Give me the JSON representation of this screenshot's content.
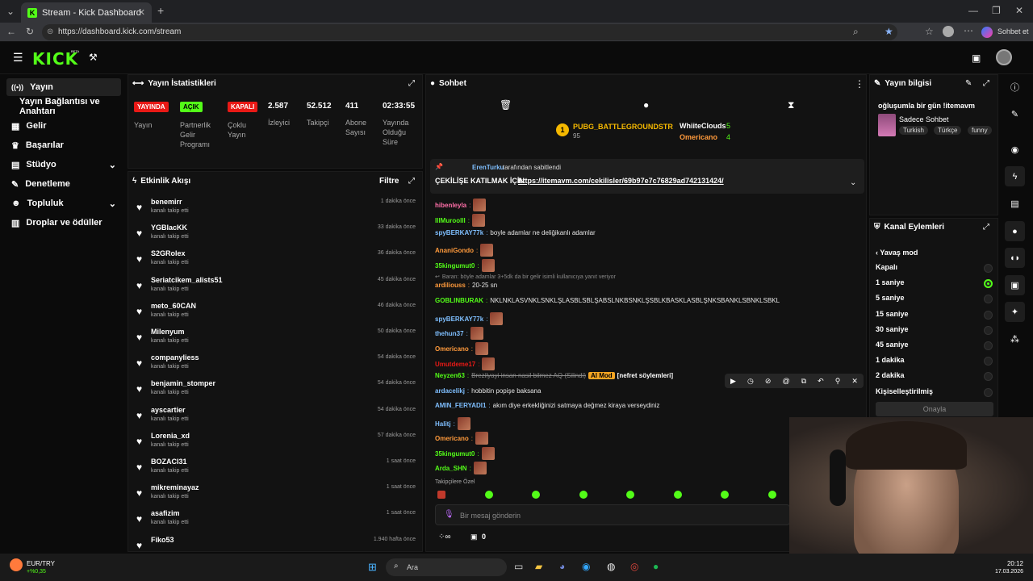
{
  "browser": {
    "tab_title": "Stream - Kick Dashboard",
    "url": "https://dashboard.kick.com/stream",
    "profile_label": "Sohbet et"
  },
  "app": {
    "logo": "KICK",
    "logo_beta": "BETA"
  },
  "sidebar": {
    "items": [
      {
        "label": "Yayın",
        "icon": "broadcast-icon"
      },
      {
        "label": "Yayın Bağlantısı ve Anahtarı",
        "icon": ""
      },
      {
        "label": "Gelir",
        "icon": "money-icon"
      },
      {
        "label": "Başarılar",
        "icon": "trophy-icon"
      },
      {
        "label": "Stüdyo",
        "icon": "studio-icon"
      },
      {
        "label": "Denetleme",
        "icon": "wrench-icon"
      },
      {
        "label": "Topluluk",
        "icon": "community-icon"
      },
      {
        "label": "Droplar ve ödüller",
        "icon": "drops-icon"
      }
    ]
  },
  "stats": {
    "title": "Yayın İstatistikleri",
    "items": [
      {
        "badge": "YAYINDA",
        "label": "Yayın",
        "badge_color": "#e91916"
      },
      {
        "badge": "AÇIK",
        "label": "Partnerlik Gelir Programı",
        "badge_color": "#53fc18"
      },
      {
        "badge": "KAPALI",
        "label": "Çoklu Yayın",
        "badge_color": "#e91916"
      },
      {
        "value": "2.587",
        "label": "İzleyici"
      },
      {
        "value": "52.512",
        "label": "Takipçi"
      },
      {
        "value": "411",
        "label": "Abone Sayısı"
      },
      {
        "value": "02:33:55",
        "label": "Yayında Olduğu Süre"
      }
    ]
  },
  "activity": {
    "title": "Etkinlik Akışı",
    "filter": "Filtre",
    "items": [
      {
        "name": "benemirr",
        "sub": "kanalı takip etti",
        "time": "1 dakika önce"
      },
      {
        "name": "YGBlacKK",
        "sub": "kanalı takip etti",
        "time": "33 dakika önce"
      },
      {
        "name": "S2GRolex",
        "sub": "kanalı takip etti",
        "time": "36 dakika önce"
      },
      {
        "name": "Seriatcikem_alists51",
        "sub": "kanalı takip etti",
        "time": "45 dakika önce"
      },
      {
        "name": "meto_60CAN",
        "sub": "kanalı takip etti",
        "time": "46 dakika önce"
      },
      {
        "name": "Milenyum",
        "sub": "kanalı takip etti",
        "time": "50 dakika önce"
      },
      {
        "name": "companyliess",
        "sub": "kanalı takip etti",
        "time": "54 dakika önce"
      },
      {
        "name": "benjamin_stomper",
        "sub": "kanalı takip etti",
        "time": "54 dakika önce"
      },
      {
        "name": "ayscartier",
        "sub": "kanalı takip etti",
        "time": "54 dakika önce"
      },
      {
        "name": "Lorenia_xd",
        "sub": "kanalı takip etti",
        "time": "57 dakika önce"
      },
      {
        "name": "BOZACI31",
        "sub": "kanalı takip etti",
        "time": "1 saat önce"
      },
      {
        "name": "mikreminayaz",
        "sub": "kanalı takip etti",
        "time": "1 saat önce"
      },
      {
        "name": "asafizim",
        "sub": "kanalı takip etti",
        "time": "1 saat önce"
      },
      {
        "name": "Fiko53",
        "sub": "",
        "time": "1.940 hafta önce"
      }
    ]
  },
  "chat": {
    "title": "Sohbet",
    "leaderboard": [
      {
        "rank": "1",
        "name": "PUBG_BATTLEGROUNDSTR",
        "score": "95"
      },
      {
        "name": "WhiiteClouds",
        "score": "5"
      },
      {
        "name": "Omericano",
        "score": "4"
      }
    ],
    "pinned": {
      "by": "ErenTurku",
      "by_suffix": "tarafından sabitlendi",
      "text": "ÇEKİLİŞE KATILMAK İÇİN",
      "link": "https://itemavm.com/cekilisler/69b97e7c76829ad742131424/"
    },
    "messages": [
      {
        "user": "hibenleyla",
        "color": "#ff6fa8",
        "text": "",
        "emote": true
      },
      {
        "user": "lllMuroolll",
        "color": "#53fc18",
        "text": "",
        "emote": true
      },
      {
        "user": "spyBERKAY77k",
        "color": "#7fbfff",
        "text": "boyle adamlar ne deliğikanlı adamlar",
        "emote": false
      },
      {
        "user": "AnaniGondo",
        "color": "#ff9a3c",
        "text": "",
        "emote": true
      },
      {
        "user": "35kingumut0",
        "color": "#53fc18",
        "text": "",
        "emote": true
      },
      {
        "reply": "Baran: böyle adamlar 3+5dk da bir gelir isimli kullanıcıya yanıt veriyor"
      },
      {
        "user": "ardiliouss",
        "color": "#ff9a3c",
        "text": "20-25 sn",
        "emote": false
      },
      {
        "user": "GOBLINBURAK",
        "color": "#53fc18",
        "text": "NKLNKLASVNKLSNKLŞLASBLSBLŞABSLNKBSNKLŞSBLKBASKLASBLŞNKSBANKLSBNKLSBKL",
        "emote": false
      },
      {
        "user": "spyBERKAY77k",
        "color": "#7fbfff",
        "text": "",
        "emote": true
      },
      {
        "user": "thehun37",
        "color": "#7fbfff",
        "text": "",
        "emote": true
      },
      {
        "user": "Omericano",
        "color": "#ff9a3c",
        "text": "",
        "emote": true
      },
      {
        "user": "Umutdeme17",
        "color": "#e91916",
        "text": "",
        "emote": true
      },
      {
        "user": "Neyzen63",
        "color": "#53fc18",
        "text": "Brezilyayi insan nasil bilmez AQ (Silindi)",
        "flag": "AI Mod",
        "flag2": "[nefret söylemleri]",
        "emote": false
      },
      {
        "user": "ardacelikj",
        "color": "#7fbfff",
        "text": "hobbitin popişe baksana",
        "emote": false
      },
      {
        "user": "AMIN_FERYADI1",
        "color": "#7fbfff",
        "text": "akım diye erkekliğinizi satmaya değmez kiraya verseydiniz",
        "emote": false
      },
      {
        "user": "Halitj",
        "color": "#7fbfff",
        "text": "",
        "emote": true
      },
      {
        "user": "Omericano",
        "color": "#ff9a3c",
        "text": "",
        "emote": true
      },
      {
        "user": "35kingumut0",
        "color": "#53fc18",
        "text": "",
        "emote": true
      },
      {
        "user": "Arda_SHN",
        "color": "#53fc18",
        "text": "",
        "emote": true
      }
    ],
    "followers_only": "Takipçilere Özel",
    "input_placeholder": "Bir mesaj gönderin",
    "counter": "0"
  },
  "stream_info": {
    "title": "Yayın bilgisi",
    "stream_title": "oğluşumla bir gün !itemavm",
    "category": "Sadece Sohbet",
    "tags": [
      "Turkish",
      "Türkçe",
      "funny"
    ]
  },
  "channel_actions": {
    "title": "Kanal Eylemleri",
    "section": "Yavaş mod",
    "options": [
      "Kapalı",
      "1 saniye",
      "5 saniye",
      "15 saniye",
      "30 saniye",
      "45 saniye",
      "1 dakika",
      "2 dakika",
      "Kişiselleştirilmiş"
    ],
    "selected": 1,
    "confirm": "Onayla"
  },
  "taskbar": {
    "search": "Ara",
    "currency_pair": "EUR/TRY",
    "currency_change": "+%0,35",
    "time": "20:12",
    "date": "17.03.2026"
  },
  "colors": {
    "brand": "#53fc18",
    "live": "#e91916"
  }
}
